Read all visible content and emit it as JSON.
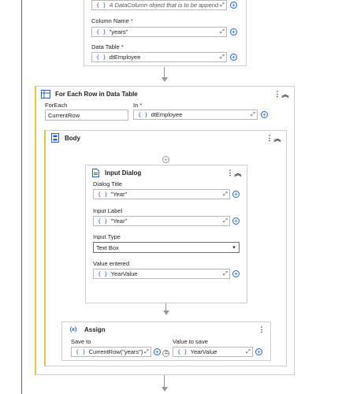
{
  "top_activity": {
    "column_hint": "A DataColumn object that is to be appended...",
    "column_name_label": "Column Name",
    "column_name_value": "\"years\"",
    "data_table_label": "Data Table",
    "data_table_value": "dtEmployee"
  },
  "for_each": {
    "title": "For Each Row in Data Table",
    "foreach_label": "ForEach",
    "foreach_value": "CurrentRow",
    "in_label": "In",
    "in_value": "dtEmployee"
  },
  "body": {
    "title": "Body"
  },
  "input_dialog": {
    "title": "Input Dialog",
    "dialog_title_label": "Dialog Title",
    "dialog_title_value": "\"Year\"",
    "input_label_label": "Input Label",
    "input_label_value": "\"Year\"",
    "input_type_label": "Input Type",
    "input_type_value": "Text Box",
    "value_entered_label": "Value entered",
    "value_entered_value": "YearValue"
  },
  "assign": {
    "icon_text": "(x)",
    "title": "Assign",
    "save_to_label": "Save to",
    "save_to_value": "CurrentRow(\"years\")",
    "equals": "=",
    "value_label": "Value to save",
    "value_value": "YearValue"
  },
  "glyphs": {
    "brace": "{ }",
    "required": "*",
    "plus": "+",
    "expand": "⤢",
    "more": "⋮",
    "collapse": "︽",
    "caret": "▾"
  },
  "colors": {
    "accent_blue": "#2563c9",
    "selection_yellow": "#e8c23a",
    "border": "#cfcfcf"
  }
}
